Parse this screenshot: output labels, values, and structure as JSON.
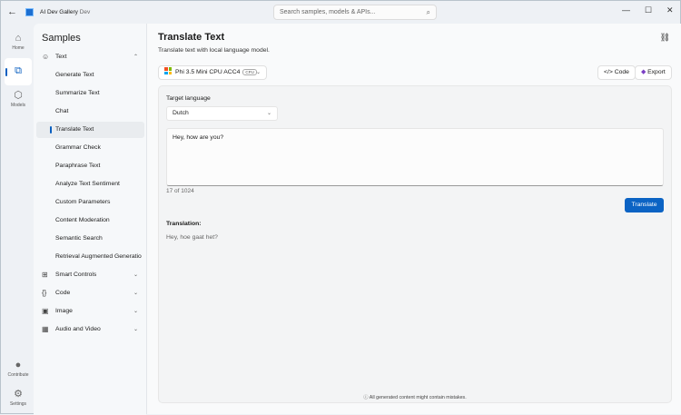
{
  "titlebar": {
    "app_name": "AI Dev Gallery",
    "app_channel": "Dev",
    "search_placeholder": "Search samples, models & APIs..."
  },
  "rail": [
    {
      "label": "Home"
    },
    {
      "label": ""
    },
    {
      "label": "Models"
    },
    {
      "label": "Contribute"
    },
    {
      "label": "Settings"
    }
  ],
  "samples": {
    "title": "Samples",
    "items": [
      {
        "label": "Text",
        "category": true,
        "expanded": true
      },
      {
        "label": "Generate Text"
      },
      {
        "label": "Summarize Text"
      },
      {
        "label": "Chat"
      },
      {
        "label": "Translate Text",
        "selected": true
      },
      {
        "label": "Grammar Check"
      },
      {
        "label": "Paraphrase Text"
      },
      {
        "label": "Analyze Text Sentiment"
      },
      {
        "label": "Custom Parameters"
      },
      {
        "label": "Content Moderation"
      },
      {
        "label": "Semantic Search"
      },
      {
        "label": "Retrieval Augmented Generation"
      },
      {
        "label": "Smart Controls",
        "category": true
      },
      {
        "label": "Code",
        "category": true
      },
      {
        "label": "Image",
        "category": true
      },
      {
        "label": "Audio and Video",
        "category": true
      }
    ]
  },
  "main": {
    "title": "Translate Text",
    "subtitle": "Translate text with local language model.",
    "model": "Phi 3.5 Mini CPU ACC4",
    "model_badge": "CPU",
    "code_label": "Code",
    "export_label": "Export",
    "target_language_label": "Target language",
    "target_language": "Dutch",
    "input_text": "Hey, how are you?",
    "char_count": "17 of 1024",
    "translate_label": "Translate",
    "translation_label": "Translation:",
    "translation": "Hey, hoe gaat het?",
    "disclaimer": "All generated content might contain mistakes."
  },
  "colors": {
    "accent": "#0b63c4"
  }
}
